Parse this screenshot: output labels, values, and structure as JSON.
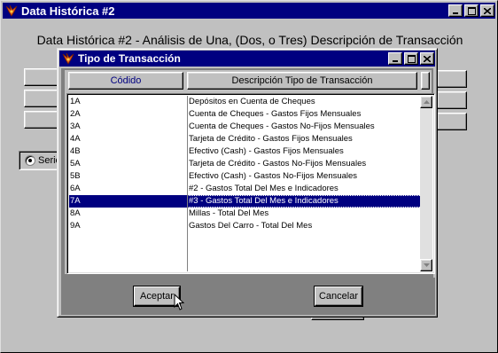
{
  "main_window": {
    "title": "Data Histórica #2",
    "heading": "Data Histórica #2 - Análisis de Una, (Dos, o Tres) Descripción de Transacción",
    "radio_label": "Serie"
  },
  "dialog": {
    "title": "Tipo de Transacción",
    "columns": {
      "code": "Códido",
      "description": "Descripción Tipo de Transacción"
    },
    "rows": [
      {
        "code": "1A",
        "description": "Depósitos en Cuenta de Cheques"
      },
      {
        "code": "2A",
        "description": "Cuenta de Cheques - Gastos Fijos Mensuales"
      },
      {
        "code": "3A",
        "description": "Cuenta de Cheques - Gastos No-Fijos Mensuales"
      },
      {
        "code": "4A",
        "description": "Tarjeta de Crédito - Gastos Fijos Mensuales"
      },
      {
        "code": "4B",
        "description": "Efectivo (Cash) - Gastos Fijos Mensuales"
      },
      {
        "code": "5A",
        "description": "Tarjeta de Crédito - Gastos No-Fijos Mensuales"
      },
      {
        "code": "5B",
        "description": "Efectivo (Cash) - Gastos No-Fijos Mensuales"
      },
      {
        "code": "6A",
        "description": "#2 - Gastos Total Del Mes e Indicadores"
      },
      {
        "code": "7A",
        "description": "#3 - Gastos Total Del Mes e Indicadores"
      },
      {
        "code": "8A",
        "description": "Millas - Total Del Mes"
      },
      {
        "code": "9A",
        "description": "Gastos Del Carro - Total Del Mes"
      }
    ],
    "selected_index": 8,
    "ok_label": "Aceptar",
    "cancel_label": "Cancelar"
  },
  "colors": {
    "titlebar": "#000080",
    "face": "#c0c0c0",
    "selection": "#000080"
  }
}
